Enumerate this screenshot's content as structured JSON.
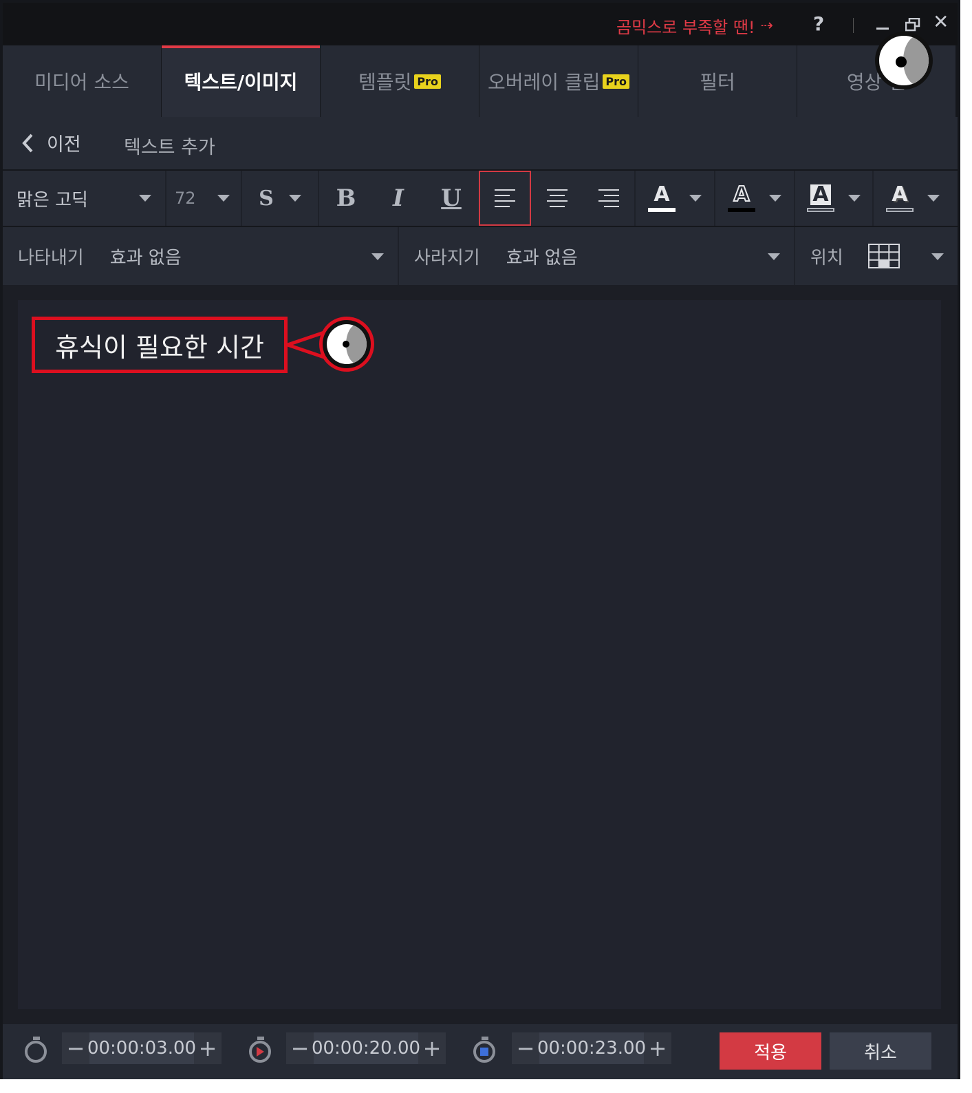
{
  "titlebar": {
    "promo_text": "곰믹스로 부족할 땐!",
    "promo_arrow": "⇢",
    "help": "?",
    "close": "✕"
  },
  "tabs": [
    {
      "label": "미디어 소스",
      "pro": ""
    },
    {
      "label": "텍스트/이미지",
      "pro": ""
    },
    {
      "label": "템플릿",
      "pro": "Pro"
    },
    {
      "label": "오버레이 클립",
      "pro": "Pro"
    },
    {
      "label": "필터",
      "pro": ""
    },
    {
      "label": "영상 전",
      "pro": ""
    }
  ],
  "subheader": {
    "back_label": "이전",
    "title": "텍스트 추가"
  },
  "toolbar": {
    "font": "맑은 고딕",
    "size": "72",
    "shadow": "S",
    "bold": "B",
    "italic": "I",
    "underline": "U",
    "color_a": "A",
    "outline_a": "A",
    "bg_a": "A",
    "shadow_a": "A",
    "text_color": "#ffffff",
    "outline_color": "#000000",
    "accent": "#d33a43"
  },
  "effects": {
    "appear_label": "나타내기",
    "appear_value": "효과 없음",
    "disappear_label": "사라지기",
    "disappear_value": "효과 없음",
    "position_label": "위치"
  },
  "canvas": {
    "text": "휴식이 필요한 시간"
  },
  "bottom": {
    "start_time": "00:00:03.00",
    "duration_time": "00:00:20.00",
    "end_time": "00:00:23.00",
    "minus": "−",
    "plus": "+",
    "apply": "적용",
    "cancel": "취소"
  }
}
